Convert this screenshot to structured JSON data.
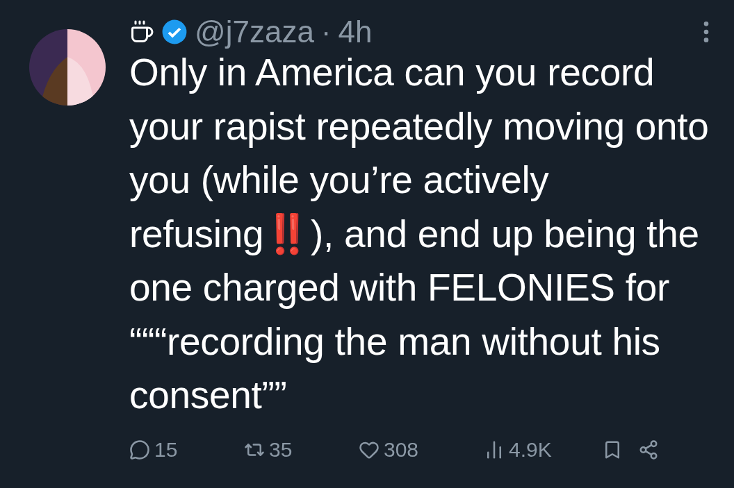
{
  "tweet": {
    "handle": "@j7zaza",
    "separator": "·",
    "time": "4h",
    "verified": true,
    "text": "Only in America can you record your rapist repeatedly moving onto you (while you’re actively refusing‼️), and end up being the one charged with FELONIES for “““recording the man without his consent””",
    "actions": [
      {
        "kind": "reply",
        "count": "15"
      },
      {
        "kind": "retweet",
        "count": "35"
      },
      {
        "kind": "like",
        "count": "308"
      },
      {
        "kind": "views",
        "count": "4.9K"
      },
      {
        "kind": "bookmark"
      },
      {
        "kind": "share"
      }
    ]
  }
}
